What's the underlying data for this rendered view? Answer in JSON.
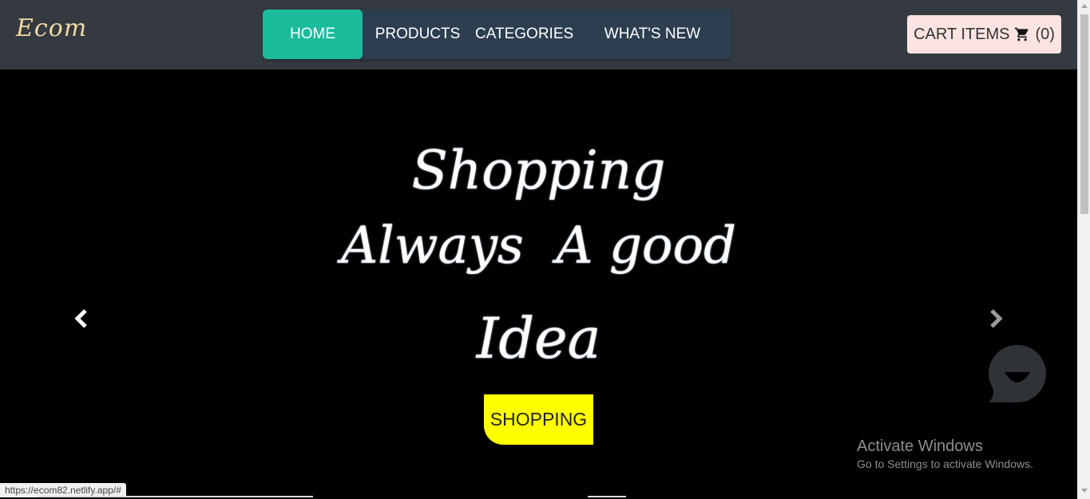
{
  "header": {
    "brand": "Ecom",
    "nav": [
      {
        "label": "HOME",
        "active": true
      },
      {
        "label": "PRODUCTS",
        "active": false
      },
      {
        "label": "CATEGORIES",
        "active": false
      },
      {
        "label": "WHAT'S NEW",
        "active": false
      }
    ],
    "cart": {
      "label": "CART ITEMS",
      "count": "(0)",
      "icon": "cart-icon"
    }
  },
  "hero": {
    "line1": "Shopping",
    "line2": "Always  A good",
    "line3": "Idea",
    "button": "SHOPPING",
    "prev_icon": "chevron-left-icon",
    "next_icon": "chevron-right-icon"
  },
  "watermark": {
    "title": "Activate Windows",
    "subtitle": "Go to Settings to activate Windows."
  },
  "status_url": "https://ecom82.netlify.app/#",
  "colors": {
    "header_bg": "#343a40",
    "nav_bg": "#2c3e50",
    "nav_active": "#1abc9c",
    "cart_bg": "#fde4e2",
    "shop_button": "#ffff00",
    "chat_bubble": "#2f3337"
  }
}
